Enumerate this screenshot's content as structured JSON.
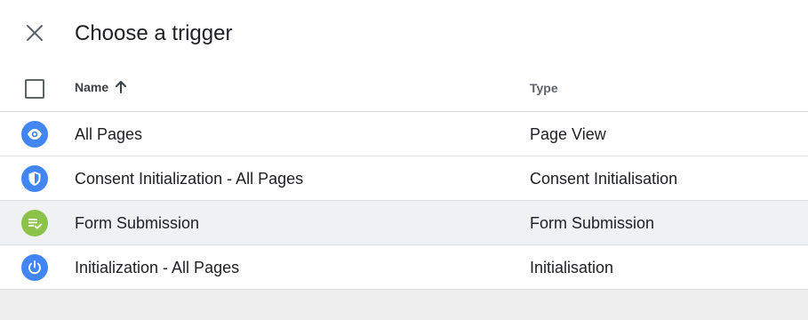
{
  "title": "Choose a trigger",
  "columns": {
    "name": "Name",
    "type": "Type"
  },
  "colors": {
    "blue": "#4285f4",
    "green": "#8bc34a",
    "hover_row": "#eff1f3"
  },
  "rows": [
    {
      "name": "All Pages",
      "type": "Page View",
      "icon": "eye-icon",
      "color": "#4285f4"
    },
    {
      "name": "Consent Initialization - All Pages",
      "type": "Consent Initialisation",
      "icon": "shield-icon",
      "color": "#4285f4"
    },
    {
      "name": "Form Submission",
      "type": "Form Submission",
      "icon": "form-check-icon",
      "color": "#8bc34a"
    },
    {
      "name": "Initialization - All Pages",
      "type": "Initialisation",
      "icon": "power-icon",
      "color": "#4285f4"
    }
  ]
}
